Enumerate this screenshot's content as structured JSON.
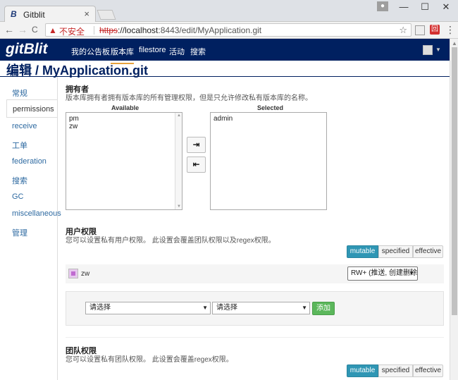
{
  "browser": {
    "tab_title": "Gitblit",
    "tab_close": "×",
    "tab_icon": "B",
    "window_min": "—",
    "window_max": "☐",
    "window_close": "✕",
    "back": "←",
    "forward": "→",
    "reload": "C",
    "insecure_label": "不安全",
    "url_scheme": "https",
    "url_host": "://localhost",
    "url_rest": ":8443/edit/MyApplication.git",
    "menu": "⋮"
  },
  "navbar": {
    "logo": "gitBlit",
    "items": [
      {
        "label": "我的公告板",
        "active": false
      },
      {
        "label": "版本库",
        "active": true
      },
      {
        "label": "filestore",
        "active": false
      },
      {
        "label": "活动",
        "active": false
      },
      {
        "label": "搜索",
        "active": false
      }
    ]
  },
  "page": {
    "title": "编辑 / MyApplication.git"
  },
  "sidebar": {
    "items": [
      {
        "label": "常规"
      },
      {
        "label": "permissions",
        "active": true
      },
      {
        "label": "receive"
      },
      {
        "label": "工单"
      },
      {
        "label": "federation"
      },
      {
        "label": "搜索"
      },
      {
        "label": "GC"
      },
      {
        "label": "miscellaneous"
      },
      {
        "label": "管理"
      }
    ]
  },
  "owners": {
    "title": "拥有者",
    "description": "版本库拥有者拥有版本库的所有管理权限，但是只允许修改私有版本库的名称。",
    "available_label": "Available",
    "selected_label": "Selected",
    "available": [
      "pm",
      "zw"
    ],
    "selected": [
      "admin"
    ],
    "move_right": "⇥",
    "move_left": "⇤"
  },
  "user_permissions": {
    "title": "用户权限",
    "description": "您可以设置私有用户权限。 此设置会覆盖团队权限以及regex权限。",
    "modes": [
      "mutable",
      "specified",
      "effective"
    ],
    "active_mode": "mutable",
    "user": "zw",
    "permission": "RW+ (推送, 创建删除",
    "select_user_placeholder": "请选择",
    "select_perm_placeholder": "请选择",
    "add_label": "添加"
  },
  "team_permissions": {
    "title": "团队权限",
    "description": "您可以设置私有团队权限。 此设置会覆盖regex权限。",
    "modes": [
      "mutable",
      "specified",
      "effective"
    ],
    "active_mode": "mutable"
  }
}
